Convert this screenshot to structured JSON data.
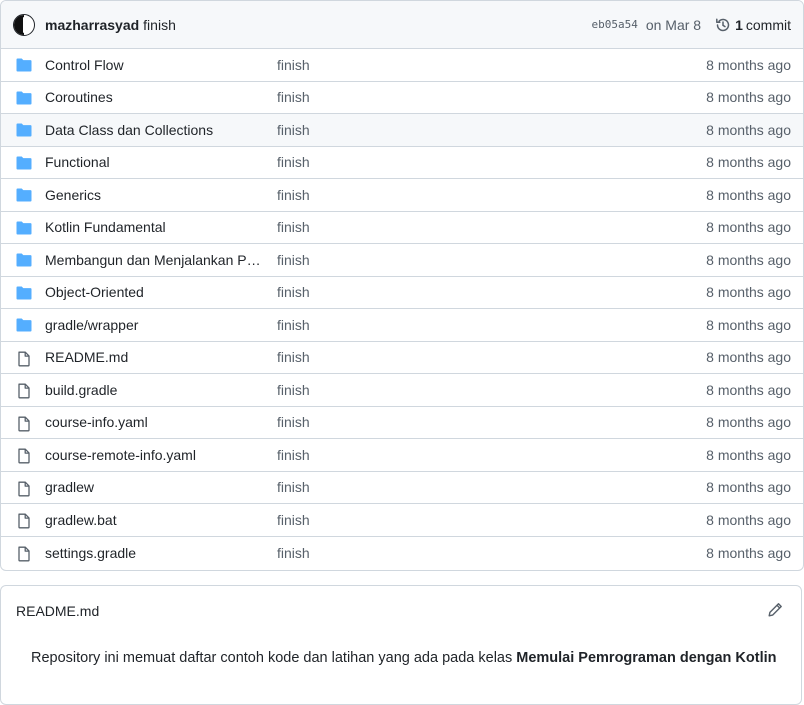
{
  "commit": {
    "author": "mazharrasyad",
    "message": "finish",
    "sha": "eb05a54",
    "date": "on Mar 8",
    "count": "1",
    "count_label": "commit"
  },
  "files": [
    {
      "type": "folder",
      "name": "Control Flow",
      "message": "finish",
      "age": "8 months ago"
    },
    {
      "type": "folder",
      "name": "Coroutines",
      "message": "finish",
      "age": "8 months ago"
    },
    {
      "type": "folder",
      "name": "Data Class dan Collections",
      "message": "finish",
      "age": "8 months ago"
    },
    {
      "type": "folder",
      "name": "Functional",
      "message": "finish",
      "age": "8 months ago"
    },
    {
      "type": "folder",
      "name": "Generics",
      "message": "finish",
      "age": "8 months ago"
    },
    {
      "type": "folder",
      "name": "Kotlin Fundamental",
      "message": "finish",
      "age": "8 months ago"
    },
    {
      "type": "folder",
      "name": "Membangun dan Menjalankan Progr...",
      "message": "finish",
      "age": "8 months ago"
    },
    {
      "type": "folder",
      "name": "Object-Oriented",
      "message": "finish",
      "age": "8 months ago"
    },
    {
      "type": "folder",
      "name": "gradle/wrapper",
      "message": "finish",
      "age": "8 months ago"
    },
    {
      "type": "file",
      "name": "README.md",
      "message": "finish",
      "age": "8 months ago"
    },
    {
      "type": "file",
      "name": "build.gradle",
      "message": "finish",
      "age": "8 months ago"
    },
    {
      "type": "file",
      "name": "course-info.yaml",
      "message": "finish",
      "age": "8 months ago"
    },
    {
      "type": "file",
      "name": "course-remote-info.yaml",
      "message": "finish",
      "age": "8 months ago"
    },
    {
      "type": "file",
      "name": "gradlew",
      "message": "finish",
      "age": "8 months ago"
    },
    {
      "type": "file",
      "name": "gradlew.bat",
      "message": "finish",
      "age": "8 months ago"
    },
    {
      "type": "file",
      "name": "settings.gradle",
      "message": "finish",
      "age": "8 months ago"
    }
  ],
  "readme": {
    "title": "README.md",
    "text": "Repository ini memuat daftar contoh kode dan latihan yang ada pada kelas ",
    "text_bold": "Memulai Pemrograman dengan Kotlin"
  },
  "colors": {
    "folder": "#54aeff",
    "file": "#57606a",
    "border": "#d0d7de",
    "header_bg": "#f6f8fa"
  },
  "hover_row": 2
}
